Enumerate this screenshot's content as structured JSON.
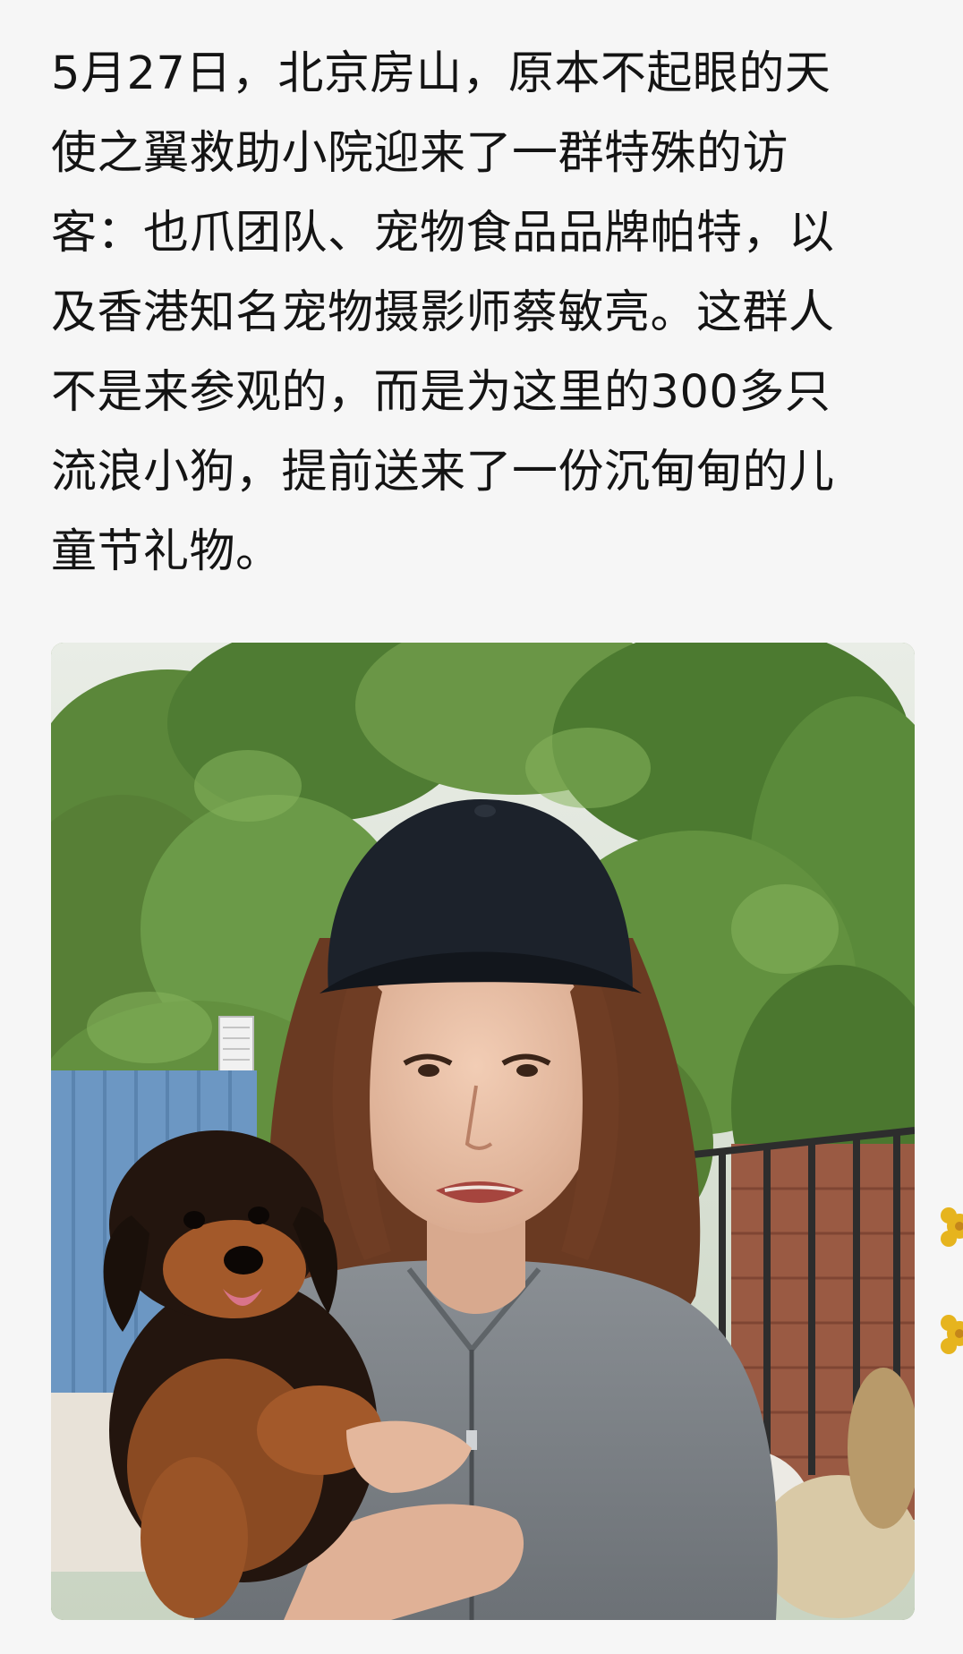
{
  "article": {
    "paragraph_lines": [
      "5月27日，北京房山，原本不起眼的天",
      "使之翼救助小院迎来了一群特殊的访",
      "客：也爪团队、宠物食品品牌帕特，以",
      "及香港知名宠物摄影师蔡敏亮。这群人",
      "不是来参观的，而是为这里的300多只",
      "流浪小狗，提前送来了一份沉甸甸的儿",
      "童节礼物。"
    ]
  },
  "photo": {
    "subject": "woman-in-cap-holding-puppy"
  },
  "colors": {
    "background": "#f6f6f6",
    "text": "#141414",
    "foliage": "#5f8a3c",
    "fence": "#6a96c2",
    "shirt": "#7d8287",
    "flower": "#e6b41e"
  }
}
